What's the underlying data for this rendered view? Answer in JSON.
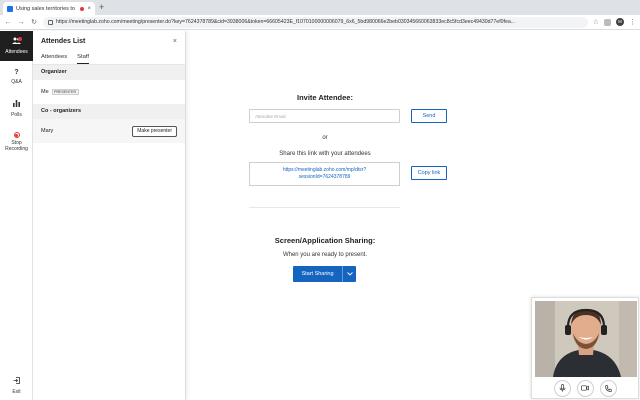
{
  "browser": {
    "tab_title": "Using sales territories to ...",
    "tab_close": "×",
    "new_tab": "+",
    "url": "https://meetinglab.zoho.com/meeting/presenter.do?key=7624378789&cid=3938006&token=66605423E_f1070100000006079_6x6_5bd980066e2beb030345660063833ec8c5fcd3eec49430d77ef0fea...",
    "profile_initial": "M"
  },
  "rail": {
    "items": [
      {
        "label": "Attendees",
        "icon": "people-icon"
      },
      {
        "label": "Q&A",
        "icon": "question-icon"
      },
      {
        "label": "Polls",
        "icon": "poll-icon"
      },
      {
        "label": "Stop Recording",
        "icon": "record-icon"
      },
      {
        "label": "Exit",
        "icon": "exit-icon"
      }
    ]
  },
  "panel": {
    "title": "Attendes List",
    "close": "×",
    "tabs": [
      {
        "label": "Attendees"
      },
      {
        "label": "Staff"
      }
    ],
    "organizer_heading": "Organizer",
    "organizer": {
      "name": "Me",
      "badge": "PRESENTER"
    },
    "coorganizers_heading": "Co - organizers",
    "coorganizer": {
      "name": "Mary",
      "action": "Make presenter"
    }
  },
  "invite": {
    "title": "Invite Attendee:",
    "email_placeholder": "Attendee Email",
    "send_label": "Send",
    "or_text": "or",
    "share_text": "Share this link with your attendees",
    "link_line1": "https://meetinglab.zoho.com/mp/dtsr?",
    "link_line2": "sessionId=7624378789",
    "copy_label": "Copy link"
  },
  "sharing": {
    "title": "Screen/Application Sharing:",
    "ready_text": "When you are ready to present.",
    "start_label": "Start Sharing"
  },
  "colors": {
    "accent": "#1565c0",
    "record": "#e53935",
    "rail_active": "#1f1f1f"
  }
}
